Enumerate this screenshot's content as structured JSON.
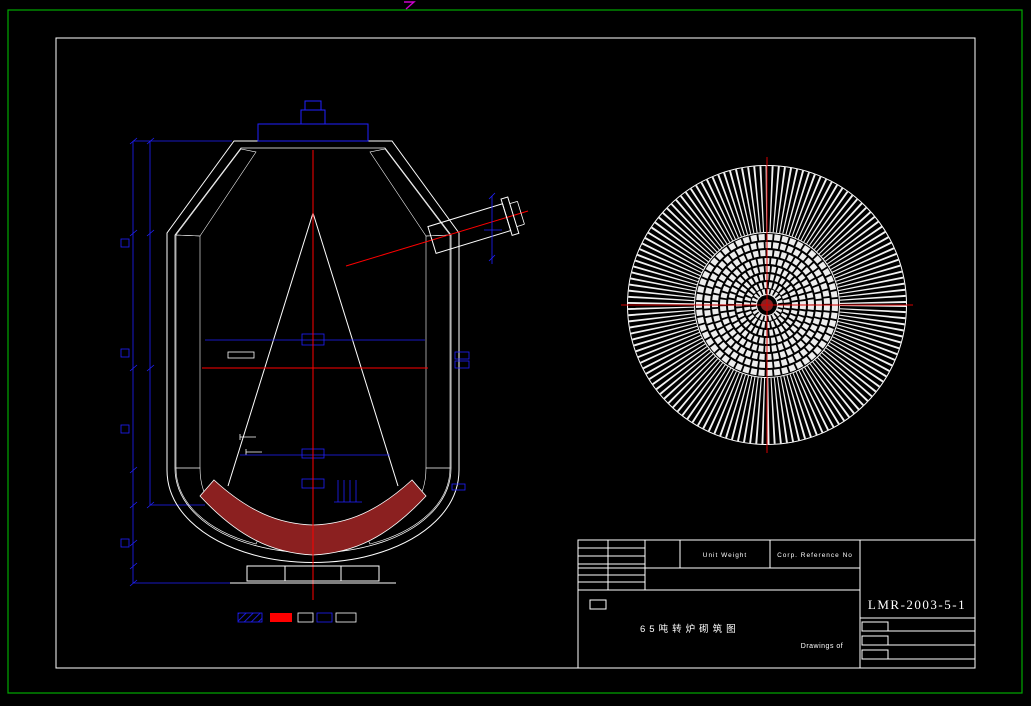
{
  "window": {
    "background": "#000000"
  },
  "borders": {
    "outer_green": "#00aa00",
    "inner_white": "#ffffff",
    "mark_magenta": "#cc00cc"
  },
  "palette": {
    "line_white": "#ffffff",
    "dimension_blue": "#2020ff",
    "centerline_red": "#ff0000",
    "plan_cross_red": "#d40000",
    "brick_maroon": "#8b2020",
    "legend_red": "#ff0000"
  },
  "legend": {
    "swatches": [
      {
        "name": "blue-hatched-brick",
        "color": "#2020ff"
      },
      {
        "name": "red-solid-brick",
        "color": "#ff0000"
      },
      {
        "name": "white-brick-small",
        "color": "#ffffff"
      },
      {
        "name": "blue-brick",
        "color": "#2020ff"
      },
      {
        "name": "white-brick-wide",
        "color": "#ffffff"
      }
    ]
  },
  "title_block": {
    "unit_weight_label": "Unit Weight",
    "corp_reference_label": "Corp. Reference No",
    "drawing_number": "LMR-2003-5-1",
    "drawing_title": "65吨转炉砌筑图",
    "drawings_of_label": "Drawings of"
  }
}
